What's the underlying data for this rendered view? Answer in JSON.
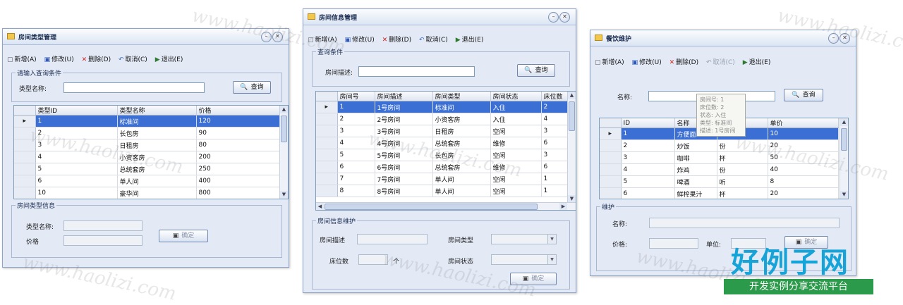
{
  "watermark": {
    "text": "www.haolizi.com",
    "brand_big": "好例子网",
    "brand_small": "开发实例分享交流平台"
  },
  "win1": {
    "title": "房间类型管理",
    "toolbar": [
      "新增(A)",
      "修改(U)",
      "删除(D)",
      "取消(C)",
      "退出(E)"
    ],
    "query_group": "请输入查询条件",
    "type_name_label": "类型名称:",
    "type_name_value": "",
    "query_button": "查询",
    "columns": [
      "类型ID",
      "类型名称",
      "价格"
    ],
    "rows": [
      [
        "1",
        "标准间",
        "120"
      ],
      [
        "2",
        "长包房",
        "90"
      ],
      [
        "3",
        "日租房",
        "80"
      ],
      [
        "4",
        "小资客房",
        "200"
      ],
      [
        "5",
        "总统套房",
        "250"
      ],
      [
        "6",
        "单人间",
        "400"
      ],
      [
        "10",
        "豪华间",
        "800"
      ]
    ],
    "info_group": "房间类型信息",
    "info_type_label": "类型名称:",
    "info_price_label": "价格",
    "confirm_button": "确定"
  },
  "win2": {
    "title": "房间信息管理",
    "toolbar": [
      "新增(A)",
      "修改(U)",
      "删除(D)",
      "取消(C)",
      "退出(E)"
    ],
    "query_group": "查询条件",
    "desc_label": "房间描述:",
    "desc_value": "",
    "query_button": "查询",
    "columns": [
      "房间号",
      "房间描述",
      "房间类型",
      "房间状态",
      "床位数"
    ],
    "rows": [
      [
        "1",
        "1号房间",
        "标准间",
        "入住",
        "2"
      ],
      [
        "2",
        "2号房间",
        "小资客房",
        "入住",
        "4"
      ],
      [
        "3",
        "3号房间",
        "日租房",
        "空闲",
        "3"
      ],
      [
        "4",
        "4号房间",
        "总统套房",
        "维修",
        "6"
      ],
      [
        "5",
        "5号房间",
        "长包房",
        "空闲",
        "3"
      ],
      [
        "6",
        "6号房间",
        "总统套房",
        "维修",
        "6"
      ],
      [
        "7",
        "7号房间",
        "单人间",
        "空闲",
        "1"
      ],
      [
        "8",
        "8号房间",
        "单人间",
        "空闲",
        "1"
      ]
    ],
    "maint_group": "房间信息维护",
    "maint_desc_label": "房间描述",
    "maint_type_label": "房间类型",
    "maint_beds_label": "床位数",
    "maint_beds_unit": "个",
    "maint_status_label": "房间状态",
    "confirm_button": "确定"
  },
  "win3": {
    "title": "餐饮维护",
    "toolbar": [
      "新增(A)",
      "修改(U)",
      "删除(D)",
      "取消(C)",
      "退出(E)"
    ],
    "name_label": "名称:",
    "name_value": "",
    "query_button": "查询",
    "columns": [
      "ID",
      "名称",
      "",
      "单价"
    ],
    "rows": [
      [
        "1",
        "方便面",
        "",
        "10"
      ],
      [
        "2",
        "炒饭",
        "份",
        "20"
      ],
      [
        "3",
        "咖啡",
        "杯",
        "50"
      ],
      [
        "4",
        "炸鸡",
        "份",
        "40"
      ],
      [
        "5",
        "啤酒",
        "听",
        "8"
      ],
      [
        "6",
        "鲜榨果汁",
        "杯",
        "20"
      ]
    ],
    "tooltip": [
      "房间号: 1",
      "床位数: 2",
      "状态: 入住",
      "类型: 标准间",
      "描述: 1号房间"
    ],
    "maint_group": "维护",
    "maint_name_label": "名称:",
    "maint_price_label": "价格:",
    "maint_unit_label": "单位:",
    "confirm_button": "确定"
  }
}
